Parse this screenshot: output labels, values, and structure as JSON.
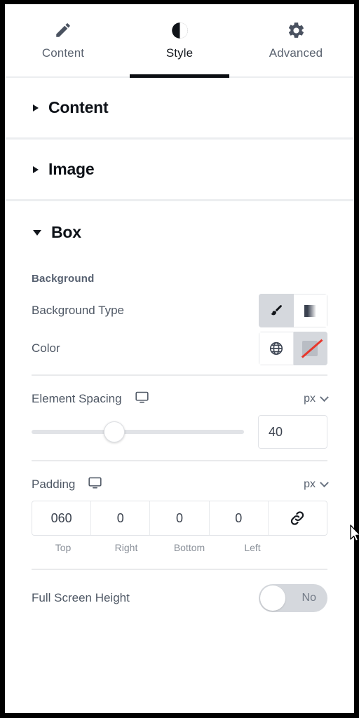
{
  "tabs": [
    {
      "label": "Content",
      "icon": "pencil-icon",
      "active": false
    },
    {
      "label": "Style",
      "icon": "contrast-circle-icon",
      "active": true
    },
    {
      "label": "Advanced",
      "icon": "gear-icon",
      "active": false
    }
  ],
  "sections": [
    {
      "title": "Content",
      "expanded": false
    },
    {
      "title": "Image",
      "expanded": false
    },
    {
      "title": "Box",
      "expanded": true
    }
  ],
  "box": {
    "background_group_label": "Background",
    "background_type": {
      "label": "Background Type",
      "options": [
        "brush-icon",
        "gradient-icon"
      ],
      "selected_index": 0
    },
    "color": {
      "label": "Color",
      "options": [
        "globe-icon",
        "no-color-swatch"
      ],
      "selected_index": 1
    },
    "element_spacing": {
      "label": "Element Spacing",
      "responsive_icon": "desktop-icon",
      "unit": "px",
      "unit_chevron": "chevron-down-icon",
      "value": "40",
      "slider_percent": 39,
      "slider_min": 0,
      "slider_max": 100
    },
    "padding": {
      "label": "Padding",
      "responsive_icon": "desktop-icon",
      "unit": "px",
      "unit_chevron": "chevron-down-icon",
      "link_icon": "link-icon",
      "values": [
        "060",
        "0",
        "0",
        "0"
      ],
      "labels": [
        "Top",
        "Right",
        "Bottom",
        "Left"
      ]
    },
    "full_screen_height": {
      "label": "Full Screen Height",
      "state_label": "No",
      "enabled": false
    }
  },
  "colors": {
    "accent_red": "#e8372c",
    "selected_bg": "#d5d8dd",
    "text_primary": "#0d1117",
    "text_secondary": "#4f5865",
    "divider": "#eceef0"
  }
}
